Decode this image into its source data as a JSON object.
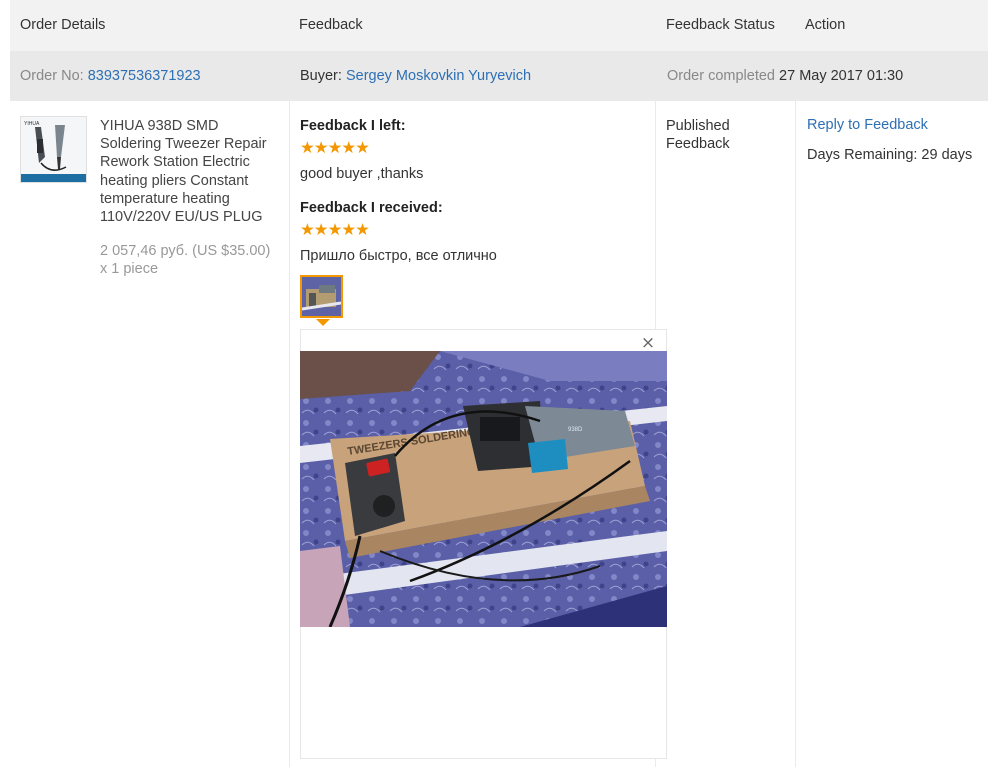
{
  "header": {
    "order_details": "Order Details",
    "feedback": "Feedback",
    "feedback_status": "Feedback Status",
    "action": "Action"
  },
  "order": {
    "order_no_label": "Order No:",
    "order_no": "83937536371923",
    "buyer_label": "Buyer:",
    "buyer_name": "Sergey Moskovkin Yuryevich",
    "status_label": "Order completed",
    "completed_date": "27 May 2017 01:30"
  },
  "product": {
    "title": "YIHUA 938D SMD Soldering Tweezer Repair Rework Station Electric heating pliers Constant temperature heating 110V/220V EU/US PLUG",
    "price": "2 057,46 руб. (US $35.00) x 1 piece",
    "thumb_brand": "YIHUA"
  },
  "feedback": {
    "left_label": "Feedback I left:",
    "left_stars": "★★★★★",
    "left_rating": 5,
    "left_text": "good buyer ,thanks",
    "received_label": "Feedback I received:",
    "received_stars": "★★★★★",
    "received_rating": 5,
    "received_text": "Пришло быстро, все отлично",
    "close_symbol": "×",
    "photo_box_text": "TWEEZERS SOLDERING IRON",
    "photo_device_text": "938D"
  },
  "status": {
    "text": "Published Feedback"
  },
  "action": {
    "reply_label": "Reply to Feedback",
    "days_remaining": "Days Remaining: 29 days"
  },
  "colors": {
    "link": "#2d6fb4",
    "star": "#f39800",
    "header_bg": "#f2f2f2",
    "order_row_bg": "#e9e9e9"
  }
}
